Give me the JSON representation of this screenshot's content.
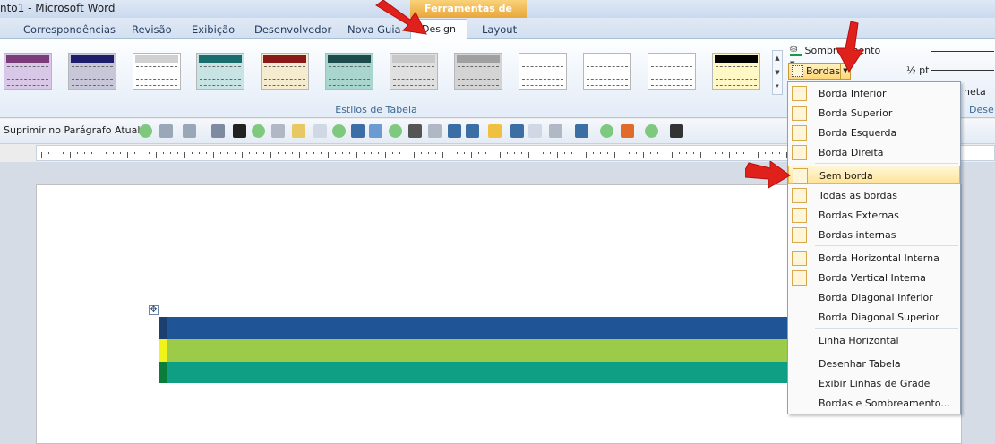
{
  "window": {
    "title": "nto1  -  Microsoft Word",
    "context_tab_group": "Ferramentas de Tabela"
  },
  "tabs": [
    {
      "label": "Correspondências"
    },
    {
      "label": "Revisão"
    },
    {
      "label": "Exibição"
    },
    {
      "label": "Desenvolvedor"
    },
    {
      "label": "Nova Guia"
    },
    {
      "label": "Design",
      "active": true
    },
    {
      "label": "Layout"
    }
  ],
  "ribbon": {
    "styles_group_label": "Estilos de Tabela",
    "shading_label": "Sombreamento",
    "borders_label": "Bordas",
    "pen_weight": "½ pt",
    "pen_color_label": "neta",
    "draw_group_label": "Dese",
    "style_header_colors": [
      "#7a3d7a",
      "#1d1d6b",
      "#d0d0d0",
      "#1a6d6d",
      "#8a1a1a",
      "#1d4a4a",
      "#c8c8c8",
      "#a0a0a0",
      "#ffffff",
      "#ffffff",
      "#ffffff",
      "#000000"
    ],
    "style_body_colors": [
      "#d9c7e8",
      "#c7c7d9",
      "#ffffff",
      "#c8e3e3",
      "#f5ecd0",
      "#a8d6cf",
      "#e0e0e0",
      "#d4d4d4",
      "#ffffff",
      "#ffffff",
      "#ffffff",
      "#fff8c4"
    ]
  },
  "qtoolbar": {
    "text": "Suprimir no Parágrafo Atual"
  },
  "menu": {
    "items": [
      {
        "label": "Borda Inferior",
        "icon": "border-bottom-icon"
      },
      {
        "label": "Borda Superior",
        "icon": "border-top-icon"
      },
      {
        "label": "Borda Esquerda",
        "icon": "border-left-icon"
      },
      {
        "label": "Borda Direita",
        "icon": "border-right-icon"
      },
      {
        "label": "Sem borda",
        "icon": "no-border-icon",
        "highlighted": true
      },
      {
        "label": "Todas as bordas",
        "icon": "all-borders-icon"
      },
      {
        "label": "Bordas Externas",
        "icon": "outside-borders-icon"
      },
      {
        "label": "Bordas internas",
        "icon": "inside-borders-icon"
      },
      {
        "label": "Borda Horizontal Interna",
        "icon": "inside-horizontal-border-icon"
      },
      {
        "label": "Borda Vertical Interna",
        "icon": "inside-vertical-border-icon"
      },
      {
        "label": "Borda Diagonal Inferior",
        "icon": "diagonal-down-border-icon"
      },
      {
        "label": "Borda Diagonal Superior",
        "icon": "diagonal-up-border-icon"
      },
      {
        "label": "Linha Horizontal",
        "icon": "horizontal-line-icon"
      },
      {
        "label": "Desenhar Tabela",
        "icon": "draw-table-icon"
      },
      {
        "label": "Exibir Linhas de Grade",
        "icon": "view-gridlines-icon"
      },
      {
        "label": "Bordas e Sombreamento...",
        "icon": "borders-shading-dialog-icon"
      }
    ]
  },
  "table": {
    "row_colors": [
      "#1f5596",
      "#9ccb4a",
      "#0f9f85"
    ],
    "accent_colors": [
      "#1b3f6e",
      "#f2f21b",
      "#0b7d3a"
    ]
  },
  "arrow_color": "#e0201a"
}
